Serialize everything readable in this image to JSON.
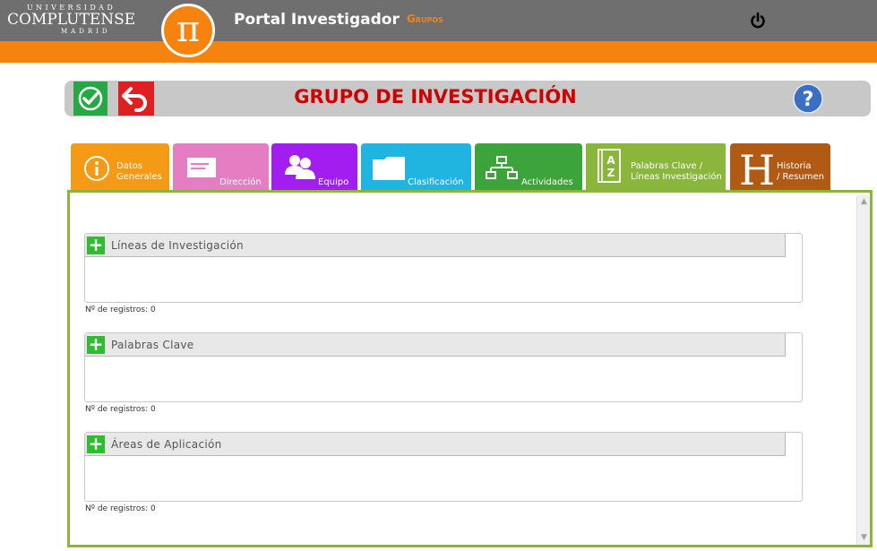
{
  "header": {
    "logo": {
      "line1": "UNIVERSIDAD",
      "line2": "COMPLUTENSE",
      "line3": "MADRID"
    },
    "pi_symbol": "π",
    "app_title": "Portal Investigador",
    "nav_link": "Grupos",
    "power_icon": "power-icon"
  },
  "actionbar": {
    "save_icon": "check-icon",
    "back_icon": "undo-arrow-icon",
    "title": "GRUPO DE INVESTIGACIÓN",
    "help_icon": "help-icon"
  },
  "tabs": [
    {
      "line1": "Datos",
      "line2": "Generales",
      "icon": "info-icon",
      "color": "#f49a14"
    },
    {
      "line1": "Dirección",
      "icon": "document-lines-icon",
      "color": "#e57dc2"
    },
    {
      "line1": "Equipo",
      "icon": "people-icon",
      "color": "#a21ef0"
    },
    {
      "line1": "Clasificación",
      "icon": "folder-icon",
      "color": "#20b4e0"
    },
    {
      "line1": "Actividades",
      "icon": "hierarchy-icon",
      "color": "#3ca43a"
    },
    {
      "line1": "Palabras Clave /",
      "line2": "Líneas Investigación",
      "icon": "dictionary-az-icon",
      "color": "#8ab63c",
      "active": true
    },
    {
      "line1": "Historia",
      "line2": "/ Resumen",
      "icon": "letter-h-icon",
      "color": "#b05a14"
    }
  ],
  "sections": [
    {
      "title": "Líneas de Investigación",
      "count_label": "Nº de registros: 0"
    },
    {
      "title": "Palabras Clave",
      "count_label": "Nº de registros: 0"
    },
    {
      "title": "Áreas de Aplicación",
      "count_label": "Nº de registros: 0"
    }
  ],
  "add_symbol": "+",
  "colors": {
    "header_gray": "#6f6f6f",
    "brand_orange": "#f7830f",
    "title_red": "#cc0000",
    "panel_green": "#8ab63c"
  }
}
